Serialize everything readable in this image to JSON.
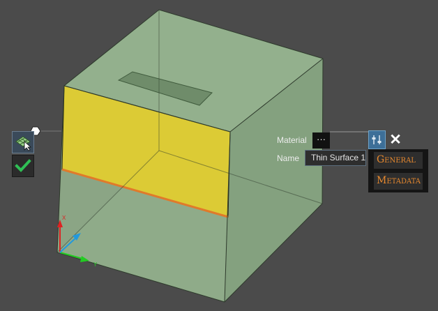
{
  "properties": {
    "material_label": "Material",
    "material_button": "···",
    "name_label": "Name",
    "name_value": "Thin Surface 1"
  },
  "menu": {
    "items": [
      {
        "label": "General"
      },
      {
        "label": "Metadata"
      }
    ]
  },
  "triad": {
    "x_label": "X",
    "y_label": "Y"
  },
  "icons": {
    "settings": "settings-sliders-icon",
    "close": "close-icon",
    "surface_select": "surface-select-icon",
    "confirm": "checkmark-icon",
    "node": "hexagon-node-icon"
  },
  "colors": {
    "background": "#4b4b4b",
    "part": "#8aa884",
    "selected_face": "#dccb35",
    "edge_highlight": "#e07a2a",
    "menu_text": "#e8892e",
    "accent": "#3d6f98"
  }
}
